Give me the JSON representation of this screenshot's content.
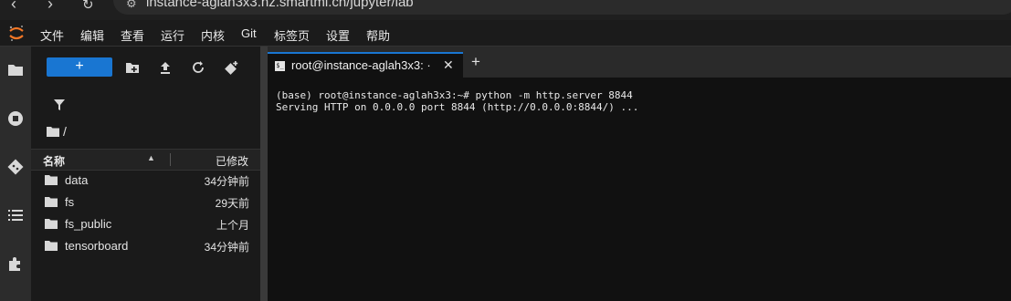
{
  "browser": {
    "url": "instance-aglah3x3.hz.smartml.cn/jupyter/lab"
  },
  "menu": [
    "文件",
    "编辑",
    "查看",
    "运行",
    "内核",
    "Git",
    "标签页",
    "设置",
    "帮助"
  ],
  "file_browser": {
    "new_label": "+",
    "breadcrumb": "/",
    "columns": {
      "name": "名称",
      "modified": "已修改"
    },
    "rows": [
      {
        "name": "data",
        "modified": "34分钟前"
      },
      {
        "name": "fs",
        "modified": "29天前"
      },
      {
        "name": "fs_public",
        "modified": "上个月"
      },
      {
        "name": "tensorboard",
        "modified": "34分钟前"
      }
    ]
  },
  "tabs": [
    {
      "label": "root@instance-aglah3x3: ·",
      "close": "✕"
    }
  ],
  "add_tab_label": "+",
  "terminal": {
    "lines": [
      "(base) root@instance-aglah3x3:~# python -m http.server 8844",
      "Serving HTTP on 0.0.0.0 port 8844 (http://0.0.0.0:8844/) ..."
    ]
  },
  "colors": {
    "accent": "#1976d2",
    "logo": "#f37726"
  }
}
